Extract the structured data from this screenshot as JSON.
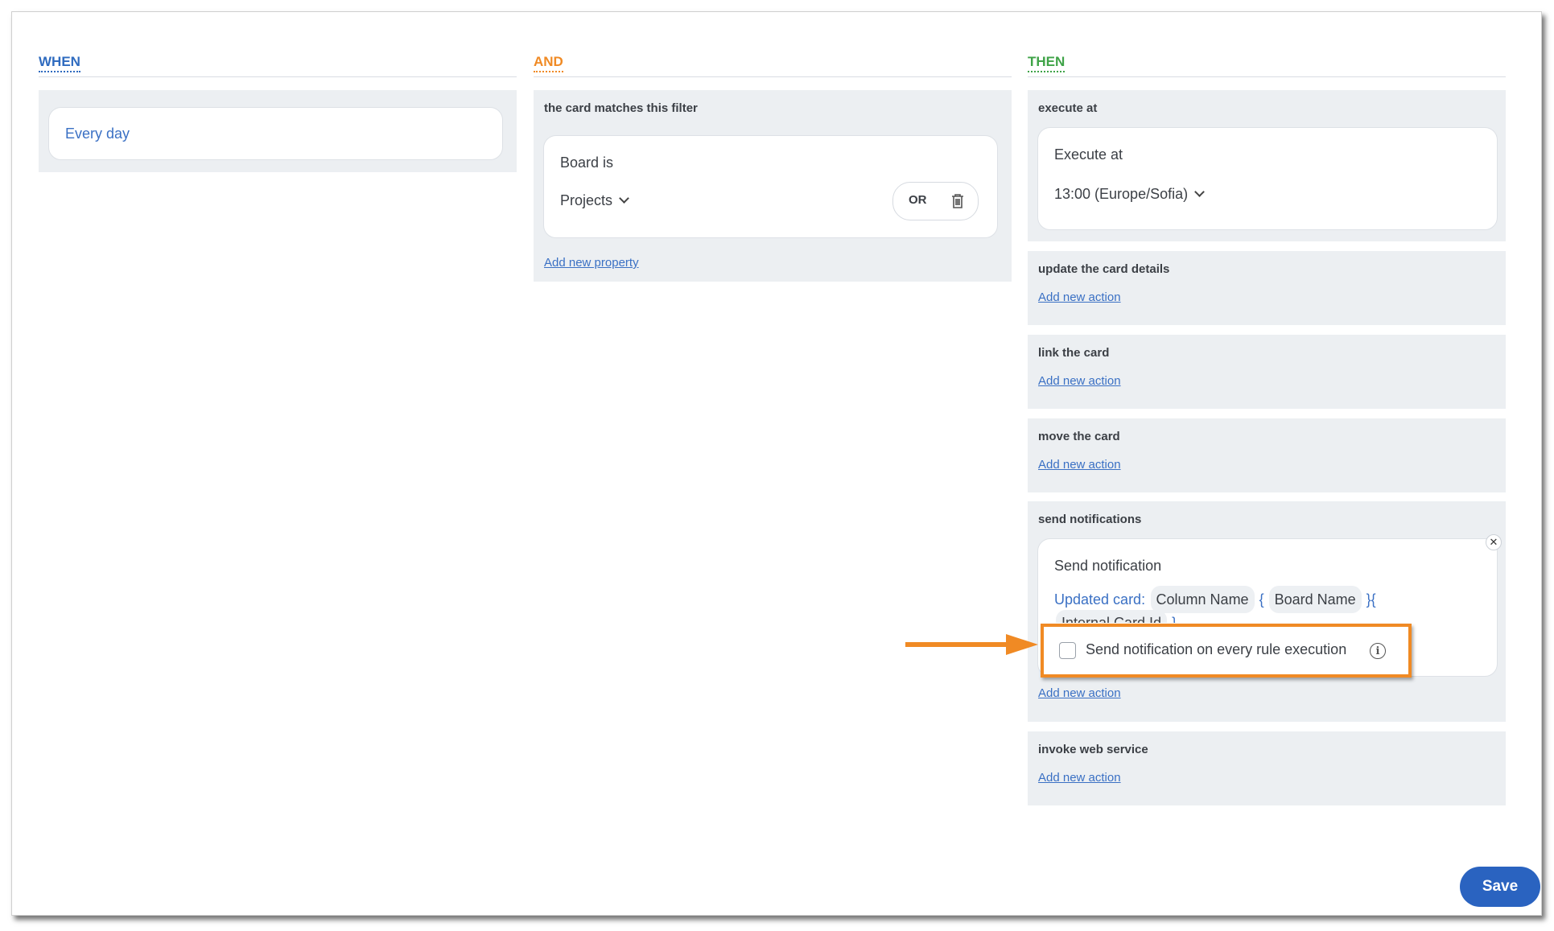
{
  "when": {
    "header": "WHEN",
    "trigger_value": "Every day"
  },
  "and": {
    "header": "AND",
    "filter_label": "the card matches this filter",
    "condition_title": "Board is",
    "condition_value": "Projects",
    "or_label": "OR",
    "add_link": "Add new property"
  },
  "then": {
    "header": "THEN",
    "execute": {
      "label": "execute at",
      "title": "Execute at",
      "value": "13:00 (Europe/Sofia)"
    },
    "update": {
      "label": "update the card details",
      "add_link": "Add new action"
    },
    "link": {
      "label": "link the card",
      "add_link": "Add new action"
    },
    "move": {
      "label": "move the card",
      "add_link": "Add new action"
    },
    "notify": {
      "label": "send notifications",
      "title": "Send notification",
      "template_prefix": "Updated card:",
      "tokens": [
        "Column Name",
        "Board Name",
        "Internal Card Id"
      ],
      "brace_open": "{",
      "brace_mid": "}{",
      "brace_close": "}",
      "checkbox_label": "Send notification on every rule execution",
      "checkbox_checked": false,
      "add_link": "Add new action"
    },
    "webservice": {
      "label": "invoke web service",
      "add_link": "Add new action"
    }
  },
  "footer": {
    "save_label": "Save"
  },
  "colors": {
    "when": "#2f6bbf",
    "and": "#f08a24",
    "then": "#3fa348",
    "highlight": "#f08a24",
    "primary_button": "#2a63c0"
  },
  "icons": [
    "chevron-down-icon",
    "trash-icon",
    "close-icon",
    "info-icon",
    "arrow-icon"
  ]
}
